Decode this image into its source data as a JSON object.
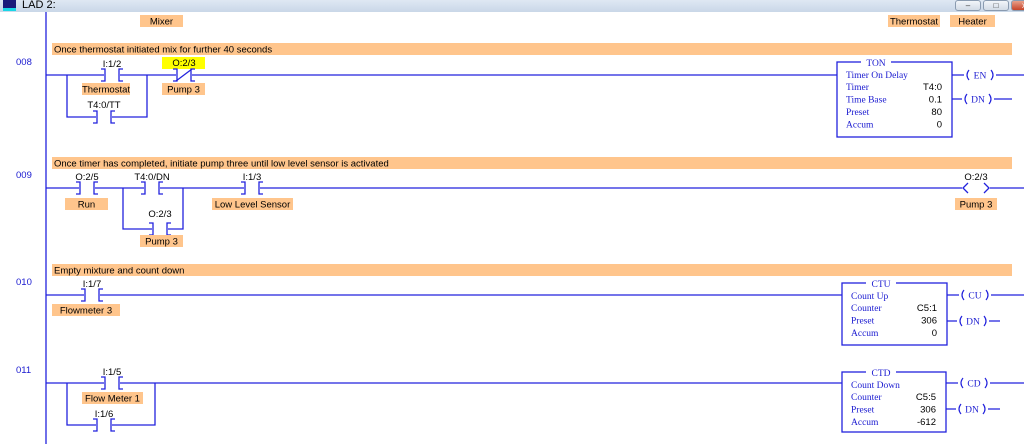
{
  "window": {
    "title": "LAD 2:",
    "minimize": "–",
    "maximize": "□",
    "close": "x"
  },
  "header_labels": {
    "mixer": "Mixer",
    "thermostat": "Thermostat",
    "heater": "Heater"
  },
  "rungs": [
    {
      "number": "008",
      "comment": "Once thermostat initiated mix for further 40 seconds",
      "contacts": [
        {
          "address": "I:1/2",
          "label": "Thermostat",
          "type": "XIC"
        },
        {
          "address": "T4:0/TT",
          "label": "",
          "type": "XIC"
        },
        {
          "address": "O:2/3",
          "label": "Pump 3",
          "type": "XIO",
          "highlighted": true
        }
      ],
      "block": {
        "type": "TON",
        "title": "Timer On Delay",
        "rows": [
          {
            "k": "Timer",
            "v": "T4:0"
          },
          {
            "k": "Time Base",
            "v": "0.1"
          },
          {
            "k": "Preset",
            "v": "80"
          },
          {
            "k": "Accum",
            "v": "0"
          }
        ],
        "outputs": [
          "EN",
          "DN"
        ]
      }
    },
    {
      "number": "009",
      "comment": "Once timer has completed, initiate pump three until low level sensor is activated",
      "contacts": [
        {
          "address": "O:2/5",
          "label": "Run",
          "type": "XIC"
        },
        {
          "address": "T4:0/DN",
          "label": "",
          "type": "XIC"
        },
        {
          "address": "O:2/3",
          "label": "Pump 3",
          "type": "XIC"
        },
        {
          "address": "I:1/3",
          "label": "Low Level Sensor",
          "type": "XIC"
        }
      ],
      "coil": {
        "address": "O:2/3",
        "label": "Pump 3"
      }
    },
    {
      "number": "010",
      "comment": "Empty mixture and count down",
      "contacts": [
        {
          "address": "I:1/7",
          "label": "Flowmeter 3",
          "type": "XIC"
        }
      ],
      "block": {
        "type": "CTU",
        "title": "Count Up",
        "rows": [
          {
            "k": "Counter",
            "v": "C5:1"
          },
          {
            "k": "Preset",
            "v": "306"
          },
          {
            "k": "Accum",
            "v": "0"
          }
        ],
        "outputs": [
          "CU",
          "DN"
        ]
      }
    },
    {
      "number": "011",
      "comment": "",
      "contacts": [
        {
          "address": "I:1/5",
          "label": "Flow Meter 1",
          "type": "XIC"
        },
        {
          "address": "I:1/6",
          "label": "",
          "type": "XIC"
        }
      ],
      "block": {
        "type": "CTD",
        "title": "Count Down",
        "rows": [
          {
            "k": "Counter",
            "v": "C5:5"
          },
          {
            "k": "Preset",
            "v": "306"
          },
          {
            "k": "Accum",
            "v": "-612"
          }
        ],
        "outputs": [
          "CD",
          "DN"
        ]
      }
    }
  ],
  "colors": {
    "wire": "#2222dd",
    "label_bg": "#ffc58c",
    "highlight": "#ffff00"
  }
}
